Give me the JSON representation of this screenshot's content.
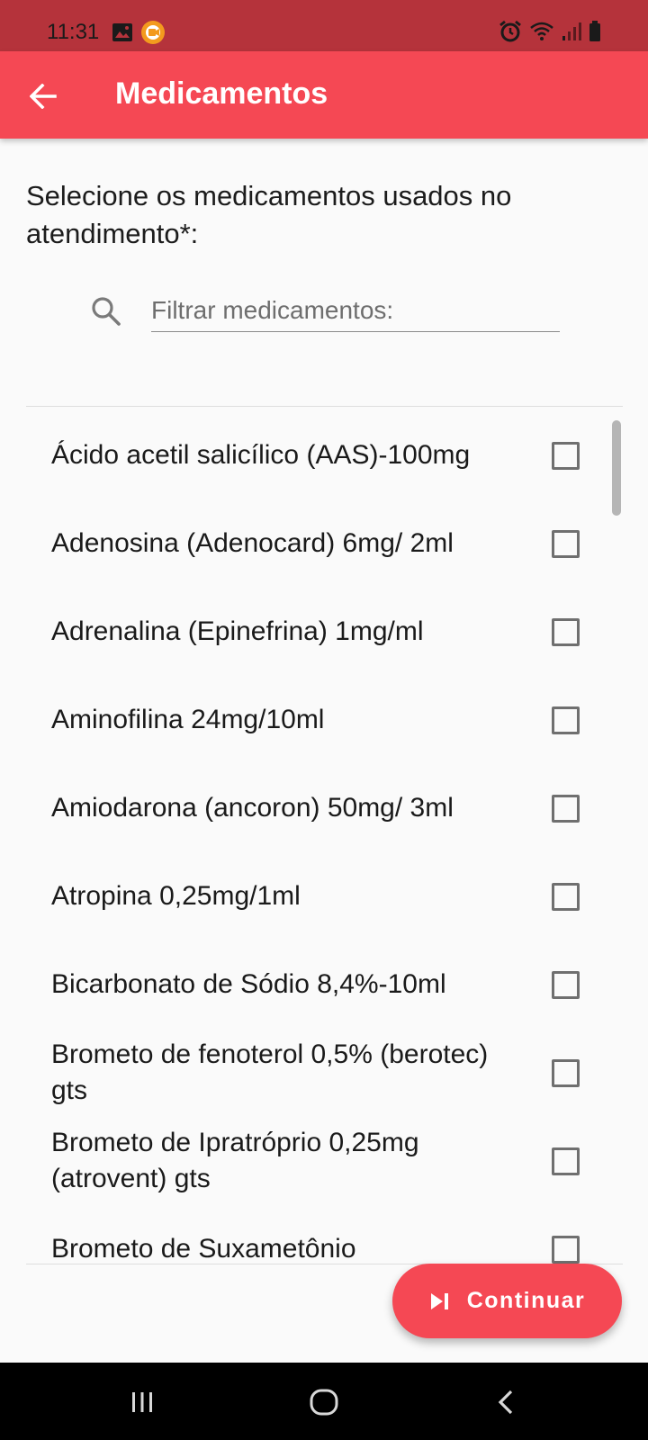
{
  "status_bar": {
    "time": "11:31",
    "left_icons": [
      "image-icon",
      "screen-record-icon"
    ],
    "right_icons": [
      "alarm-icon",
      "wifi-icon",
      "signal-icon",
      "battery-icon"
    ]
  },
  "app_bar": {
    "title": "Medicamentos",
    "back_icon": "arrow-back-icon",
    "color": "#f54854"
  },
  "prompt": "Selecione os medicamentos usados no atendimento*:",
  "search": {
    "placeholder": "Filtrar medicamentos:",
    "value": ""
  },
  "medications": [
    {
      "label": "Ácido acetil salicílico (AAS)-100mg",
      "checked": false
    },
    {
      "label": "Adenosina (Adenocard) 6mg/ 2ml",
      "checked": false
    },
    {
      "label": "Adrenalina (Epinefrina) 1mg/ml",
      "checked": false
    },
    {
      "label": "Aminofilina 24mg/10ml",
      "checked": false
    },
    {
      "label": "Amiodarona (ancoron) 50mg/ 3ml",
      "checked": false
    },
    {
      "label": "Atropina 0,25mg/1ml",
      "checked": false
    },
    {
      "label": "Bicarbonato de Sódio 8,4%-10ml",
      "checked": false
    },
    {
      "label": "Brometo de fenoterol 0,5% (berotec) gts",
      "checked": false
    },
    {
      "label": "Brometo de Ipratróprio 0,25mg (atrovent) gts",
      "checked": false
    },
    {
      "label": "Brometo de Suxametônio",
      "checked": false
    }
  ],
  "fab": {
    "label": "Continuar",
    "icon": "skip-next-icon"
  },
  "nav_bar": {
    "buttons": [
      "recent-apps-icon",
      "home-icon",
      "back-icon"
    ]
  }
}
